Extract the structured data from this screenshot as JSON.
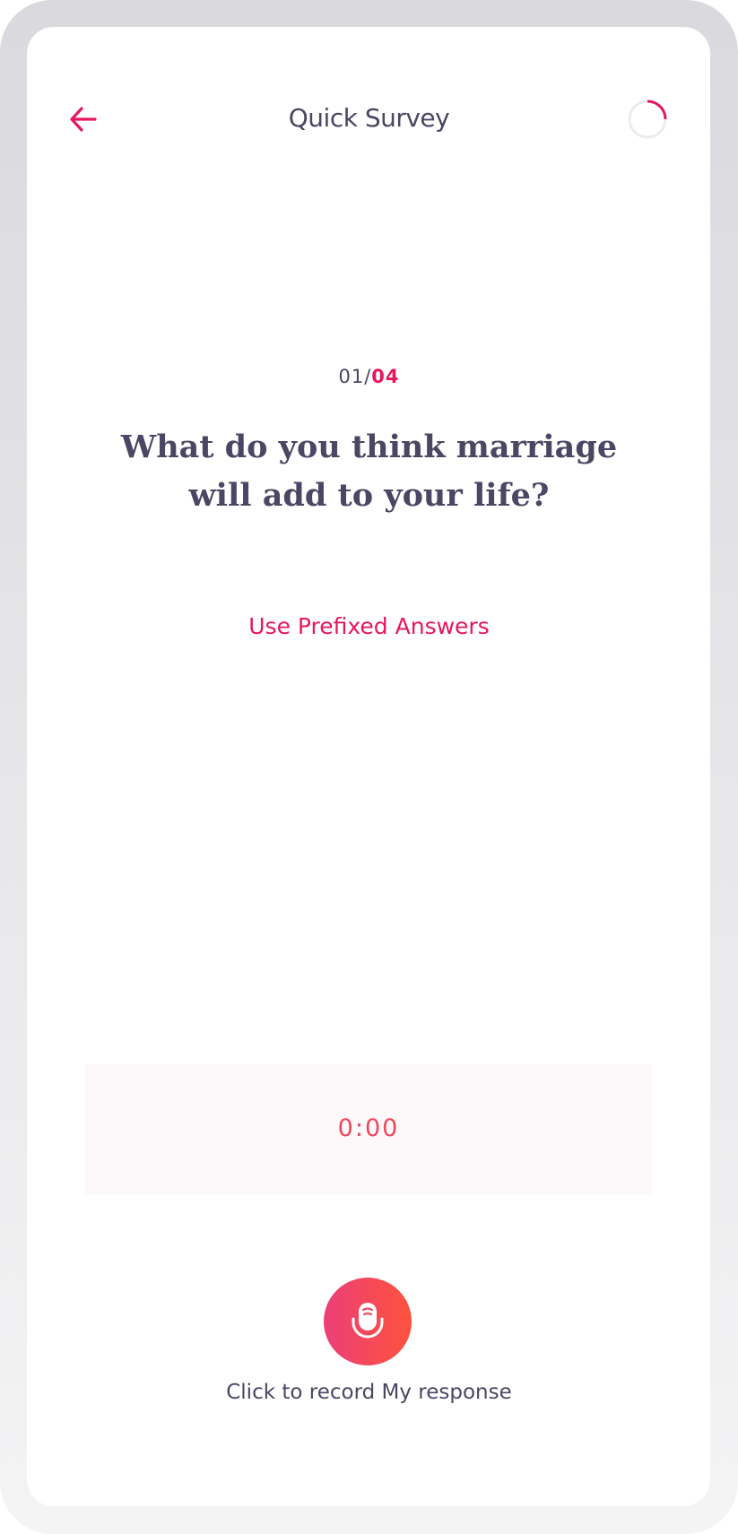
{
  "header": {
    "title": "Quick Survey",
    "progress_fraction": 0.25
  },
  "question": {
    "index": "01/",
    "total": "04",
    "text": "What do you think marriage will add to your life?"
  },
  "prefixed_link": "Use Prefixed Answers",
  "recorder": {
    "timer": "0:00",
    "cta": "Click to record My response"
  },
  "colors": {
    "accent": "#e8175d",
    "text": "#4a4663",
    "gradient_start": "#ea3f78",
    "gradient_end": "#ff523d"
  }
}
